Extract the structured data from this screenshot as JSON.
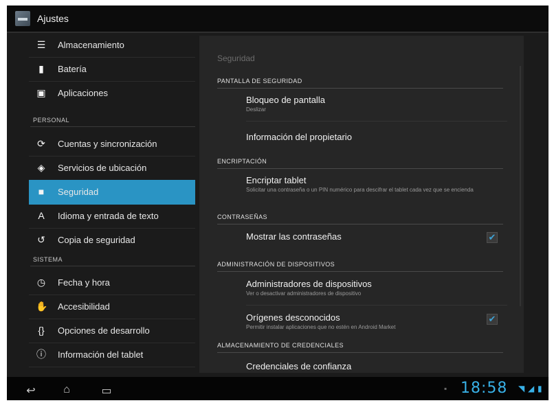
{
  "window": {
    "title": "Ajustes"
  },
  "sidebar": {
    "items": [
      {
        "label": "Almacenamiento",
        "icon": "storage-icon"
      },
      {
        "label": "Batería",
        "icon": "battery-icon"
      },
      {
        "label": "Aplicaciones",
        "icon": "apps-icon"
      },
      {
        "label": "Cuentas y sincronización",
        "icon": "sync-icon"
      },
      {
        "label": "Servicios de ubicación",
        "icon": "location-icon"
      },
      {
        "label": "Seguridad",
        "icon": "lock-icon",
        "selected": true
      },
      {
        "label": "Idioma y entrada de texto",
        "icon": "language-icon"
      },
      {
        "label": "Copia de seguridad",
        "icon": "backup-icon"
      },
      {
        "label": "Fecha y hora",
        "icon": "clock-icon"
      },
      {
        "label": "Accesibilidad",
        "icon": "hand-icon"
      },
      {
        "label": "Opciones de desarrollo",
        "icon": "braces-icon"
      },
      {
        "label": "Información del tablet",
        "icon": "info-icon"
      }
    ],
    "sections": {
      "personal": "PERSONAL",
      "system": "SISTEMA"
    }
  },
  "main": {
    "title": "Seguridad",
    "categories": {
      "screen_security": "PANTALLA DE SEGURIDAD",
      "encryption": "ENCRIPTACIÓN",
      "passwords": "CONTRASEÑAS",
      "device_admin": "ADMINISTRACIÓN DE DISPOSITIVOS",
      "credential_storage": "ALMACENAMIENTO DE CREDENCIALES"
    },
    "prefs": {
      "screen_lock": {
        "title": "Bloqueo de pantalla",
        "summary": "Deslizar"
      },
      "owner_info": {
        "title": "Información del propietario"
      },
      "encrypt": {
        "title": "Encriptar tablet",
        "summary": "Solicitar una contraseña o un PIN numérico para descifrar el tablet cada vez que se encienda"
      },
      "show_passwords": {
        "title": "Mostrar las contraseñas",
        "checked": true
      },
      "device_admins": {
        "title": "Administradores de dispositivos",
        "summary": "Ver o desactivar administradores de dispositivo"
      },
      "unknown_sources": {
        "title": "Orígenes desconocidos",
        "summary": "Permitir instalar aplicaciones que no estén en Android Market",
        "checked": true
      },
      "trusted_credentials": {
        "title": "Credenciales de confianza"
      }
    }
  },
  "status_bar": {
    "time": "18:58"
  },
  "colors": {
    "accent": "#2a94c4",
    "clock": "#38b0e6"
  }
}
